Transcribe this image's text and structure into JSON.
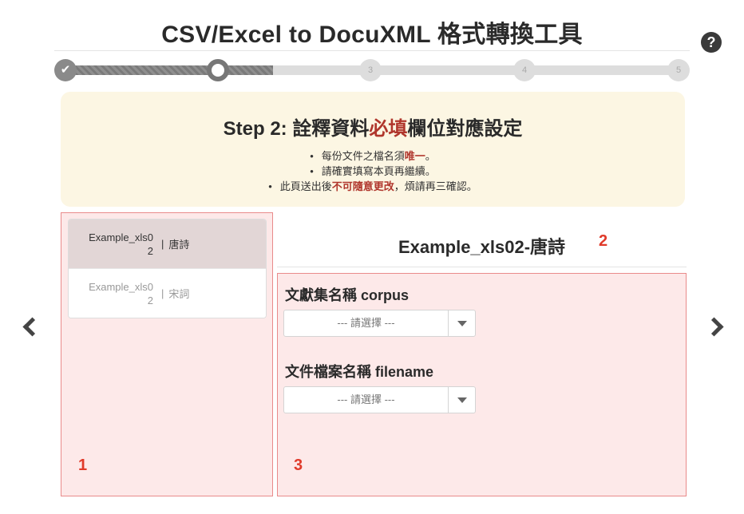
{
  "page": {
    "title": "CSV/Excel to DocuXML 格式轉換工具",
    "help_icon": "question-circle-icon"
  },
  "stepper": {
    "steps": [
      {
        "label": "✔",
        "state": "done"
      },
      {
        "label": "",
        "state": "current"
      },
      {
        "label": "3",
        "state": "pending"
      },
      {
        "label": "4",
        "state": "pending"
      },
      {
        "label": "5",
        "state": "pending"
      }
    ]
  },
  "notice": {
    "title_prefix": "Step 2: 詮釋資料",
    "title_emph": "必填",
    "title_suffix": "欄位對應設定",
    "item1_prefix": "每份文件之檔名須",
    "item1_emph": "唯一",
    "item1_suffix": "。",
    "item2": "請確實填寫本頁再繼續。",
    "item3_prefix": "此頁送出後",
    "item3_emph": "不可隨意更改",
    "item3_suffix": "，煩請再三確認。"
  },
  "files": [
    {
      "name_line1": "Example_xls0",
      "name_line2": "2",
      "sep": "|",
      "sheet": "唐詩",
      "active": true
    },
    {
      "name_line1": "Example_xls0",
      "name_line2": "2",
      "sep": "|",
      "sheet": "宋詞",
      "active": false
    }
  ],
  "sheet_title": "Example_xls02-唐詩",
  "fields": {
    "corpus": {
      "label": "文獻集名稱 corpus",
      "selected": "--- 請選擇 ---"
    },
    "filename": {
      "label": "文件檔案名稱 filename",
      "selected": "--- 請選擇 ---"
    }
  },
  "markers": {
    "m1": "1",
    "m2": "2",
    "m3": "3"
  },
  "nav": {
    "prev_icon": "chevron-left-icon",
    "next_icon": "chevron-right-icon"
  },
  "colors": {
    "highlight_red": "#b0362c",
    "marker_red": "#e03a2a",
    "notice_bg": "#fcf6e3",
    "frame_bg": "#fde9e9"
  }
}
